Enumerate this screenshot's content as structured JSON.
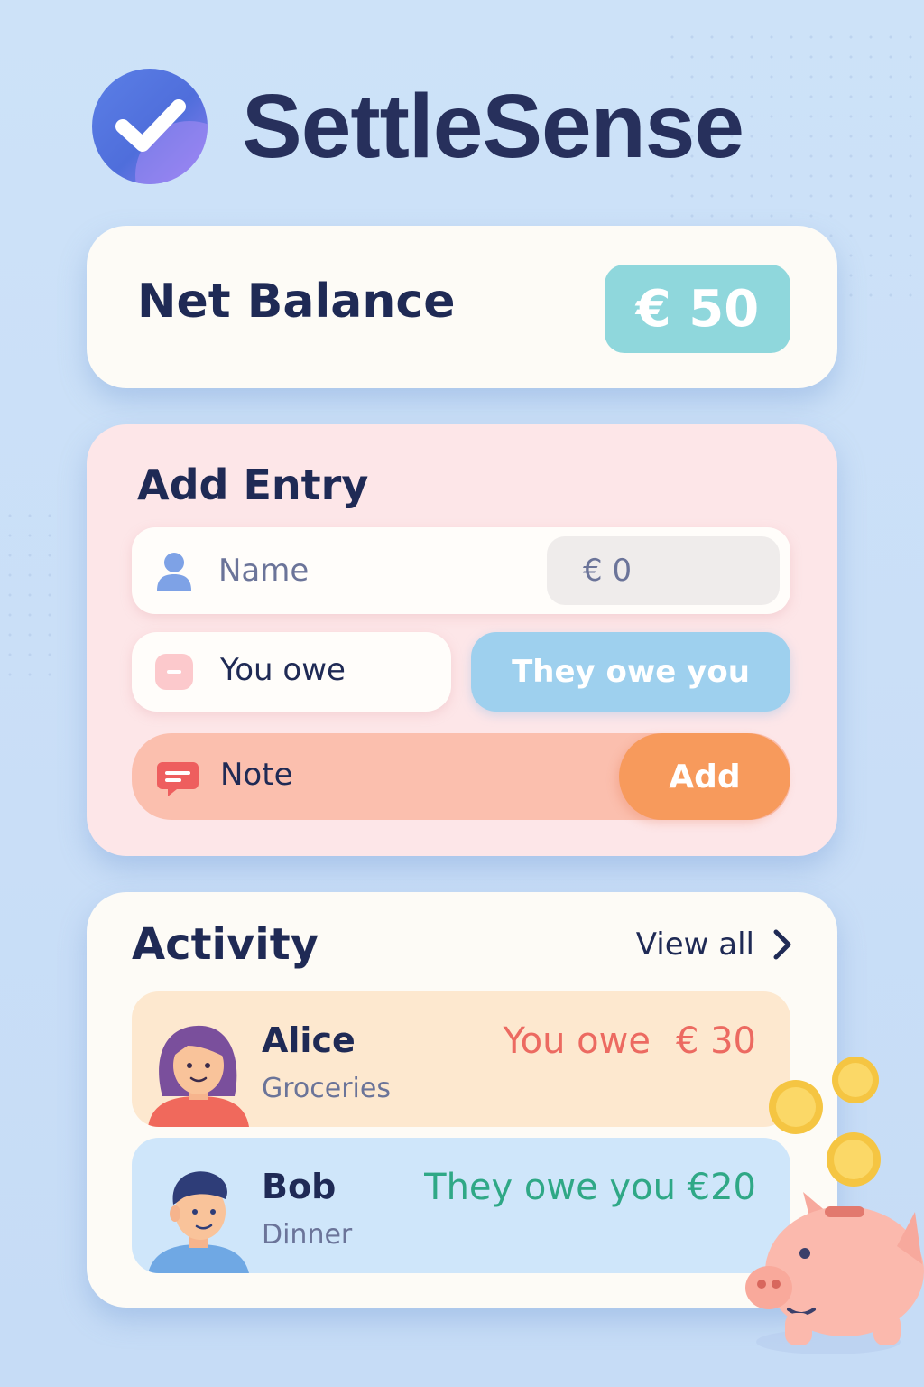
{
  "app": {
    "title": "SettleSense"
  },
  "balance": {
    "label": "Net Balance",
    "amount": "€ 50"
  },
  "entry": {
    "title": "Add Entry",
    "name_placeholder": "Name",
    "amount_placeholder": "€ 0",
    "you_owe_label": "You owe",
    "they_owe_label": "They owe you",
    "note_label": "Note",
    "add_label": "Add"
  },
  "activity": {
    "title": "Activity",
    "view_all": "View all",
    "items": [
      {
        "name": "Alice",
        "note": "Groceries",
        "status": "You owe",
        "amount": "€ 30",
        "color": "#ec6a61"
      },
      {
        "name": "Bob",
        "note": "Dinner",
        "status": "They owe you €20",
        "color": "#2fa886"
      }
    ]
  },
  "colors": {
    "accent": "#f79a5c",
    "balance_pill": "#8fd7dc",
    "they_owe": "#9ed0ee"
  }
}
